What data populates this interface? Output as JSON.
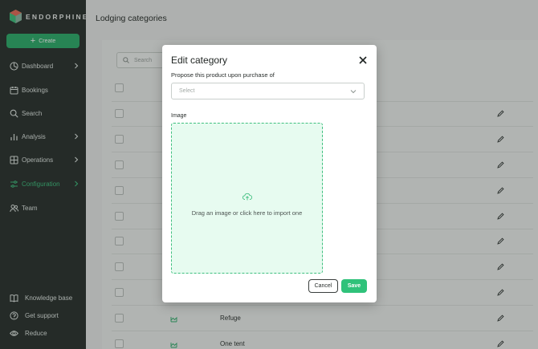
{
  "brand": {
    "name": "ENDORPHINE"
  },
  "sidebar": {
    "create_label": "Create",
    "items": [
      {
        "label": "Dashboard",
        "icon": "clock-icon",
        "has_chevron": true,
        "active": false
      },
      {
        "label": "Bookings",
        "icon": "calendar-icon",
        "has_chevron": false,
        "active": false
      },
      {
        "label": "Search",
        "icon": "search-icon",
        "has_chevron": false,
        "active": false
      },
      {
        "label": "Analysis",
        "icon": "bar-chart-icon",
        "has_chevron": true,
        "active": false
      },
      {
        "label": "Operations",
        "icon": "grid-icon",
        "has_chevron": true,
        "active": false
      },
      {
        "label": "Configuration",
        "icon": "sliders-icon",
        "has_chevron": true,
        "active": true
      },
      {
        "label": "Team",
        "icon": "users-icon",
        "has_chevron": false,
        "active": false
      }
    ],
    "bottom_items": [
      {
        "label": "Knowledge base",
        "icon": "book-icon"
      },
      {
        "label": "Get support",
        "icon": "help-circle-icon"
      },
      {
        "label": "Reduce",
        "icon": "eye-icon"
      }
    ]
  },
  "main": {
    "title": "Lodging categories",
    "search_placeholder": "Search",
    "rows": [
      {
        "name": ""
      },
      {
        "name": ""
      },
      {
        "name": ""
      },
      {
        "name": ""
      },
      {
        "name": ""
      },
      {
        "name": ""
      },
      {
        "name": ""
      },
      {
        "name": ""
      },
      {
        "name": "Refuge"
      },
      {
        "name": "One tent"
      }
    ]
  },
  "modal": {
    "title": "Edit category",
    "propose_label": "Propose this product upon purchase of",
    "select_placeholder": "Select",
    "image_label": "Image",
    "dropzone_text": "Drag an image or click here to import one",
    "cancel_label": "Cancel",
    "save_label": "Save"
  },
  "colors": {
    "accent": "#2fc27a",
    "sidebar_bg": "#2b3330",
    "dropzone_bg": "#e7fbf0"
  }
}
